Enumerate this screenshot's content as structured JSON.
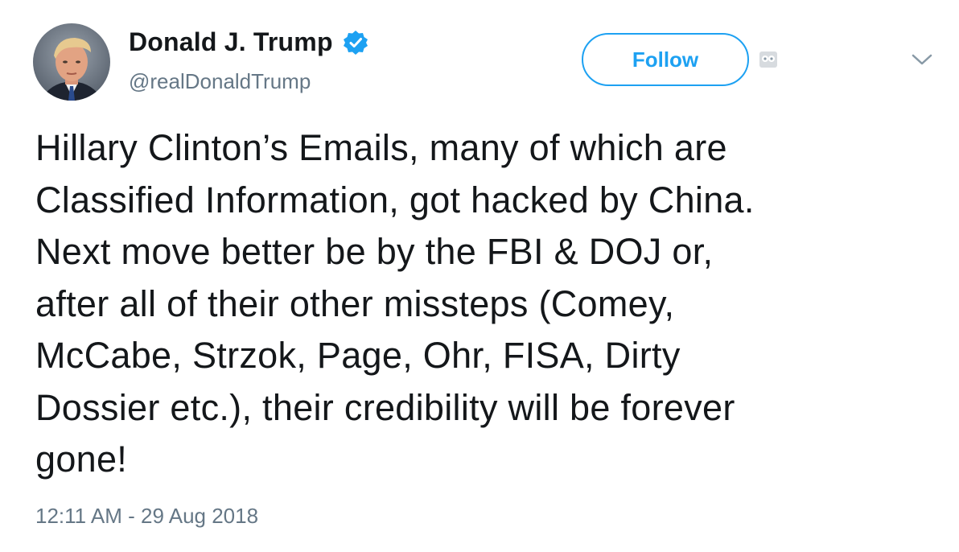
{
  "tweet": {
    "author": {
      "display_name": "Donald J. Trump",
      "handle": "@realDonaldTrump",
      "verified": true,
      "avatar_icon": "profile-photo"
    },
    "follow_label": "Follow",
    "text": "Hillary Clinton’s Emails, many of which are\nClassified Information, got hacked by China.\nNext move better be by the FBI & DOJ or,\nafter all of their other missteps (Comey,\nMcCabe, Strzok, Page, Ohr, FISA, Dirty\nDossier etc.), their credibility will be forever\ngone!",
    "timestamp": "12:11 AM - 29 Aug 2018"
  },
  "colors": {
    "accent": "#1da1f2",
    "text_primary": "#14171a",
    "text_secondary": "#657786"
  },
  "icons": {
    "verified": "verified-badge-icon",
    "owl": "owl-icon",
    "menu": "chevron-down-icon"
  }
}
